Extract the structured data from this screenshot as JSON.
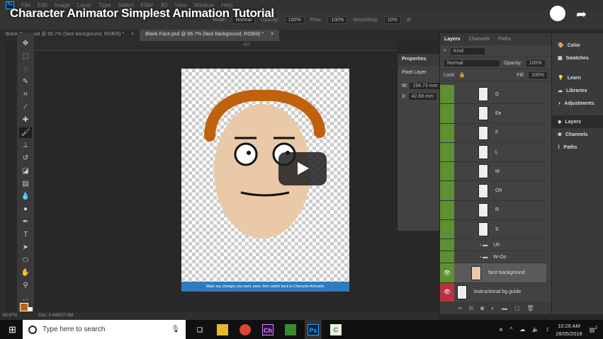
{
  "video_title": "Character Animator Simplest Animation Tutorial",
  "menu": [
    "File",
    "Edit",
    "Image",
    "Layer",
    "Type",
    "Select",
    "Filter",
    "3D",
    "View",
    "Window",
    "Help"
  ],
  "options": {
    "mode_label": "Mode:",
    "mode": "Normal",
    "opacity_label": "Opacity:",
    "opacity": "100%",
    "flow_label": "Flow:",
    "flow": "100%",
    "smoothing_label": "Smoothing:",
    "smoothing": "10%"
  },
  "tabs": [
    {
      "label": "Blank Face.psd @ 66.7% (face background, RGB/8) *"
    },
    {
      "label": "Blank Face.psd @ 66.7% (face background, RGB/8) *"
    }
  ],
  "ruler_label": "400",
  "document": {
    "banner": "Make any changes you want, save, then switch back to Character Animator."
  },
  "properties": {
    "title": "Properties",
    "type": "Pixel Layer",
    "w_label": "W:",
    "w": "194.73 mm",
    "x_label": "X:",
    "x": "42.69 mm"
  },
  "layers_panel": {
    "tabs": [
      "Layers",
      "Channels",
      "Paths"
    ],
    "kind": "Kind",
    "blend": "Normal",
    "opacity_label": "Opacity:",
    "opacity": "100%",
    "lock_label": "Lock:",
    "fill_label": "Fill:",
    "fill": "100%",
    "layers": [
      {
        "name": "D",
        "type": "layer"
      },
      {
        "name": "Ee",
        "type": "layer"
      },
      {
        "name": "F",
        "type": "layer"
      },
      {
        "name": "L",
        "type": "layer"
      },
      {
        "name": "M",
        "type": "layer"
      },
      {
        "name": "Oh",
        "type": "layer"
      },
      {
        "name": "R",
        "type": "layer"
      },
      {
        "name": "S",
        "type": "layer"
      },
      {
        "name": "Uh",
        "type": "folder"
      },
      {
        "name": "W-Oo",
        "type": "folder"
      }
    ],
    "face_layer": "face background",
    "guide_layer": "instructional bg guide"
  },
  "dock": [
    "Color",
    "Swatches",
    "Learn",
    "Libraries",
    "Adjustments",
    "Layers",
    "Channels",
    "Paths"
  ],
  "status": {
    "zoom": "66.67%",
    "doc": "Doc: 2.44M/27.8M"
  },
  "taskbar": {
    "search_placeholder": "Type here to search",
    "time": "10:26 AM",
    "date": "28/05/2018",
    "notifications": "2",
    "apps": [
      "Ch",
      "Ps"
    ]
  },
  "colors": {
    "foreground": "#c0620c",
    "layer_green": "#5f9030",
    "layer_red": "#b8323e"
  }
}
